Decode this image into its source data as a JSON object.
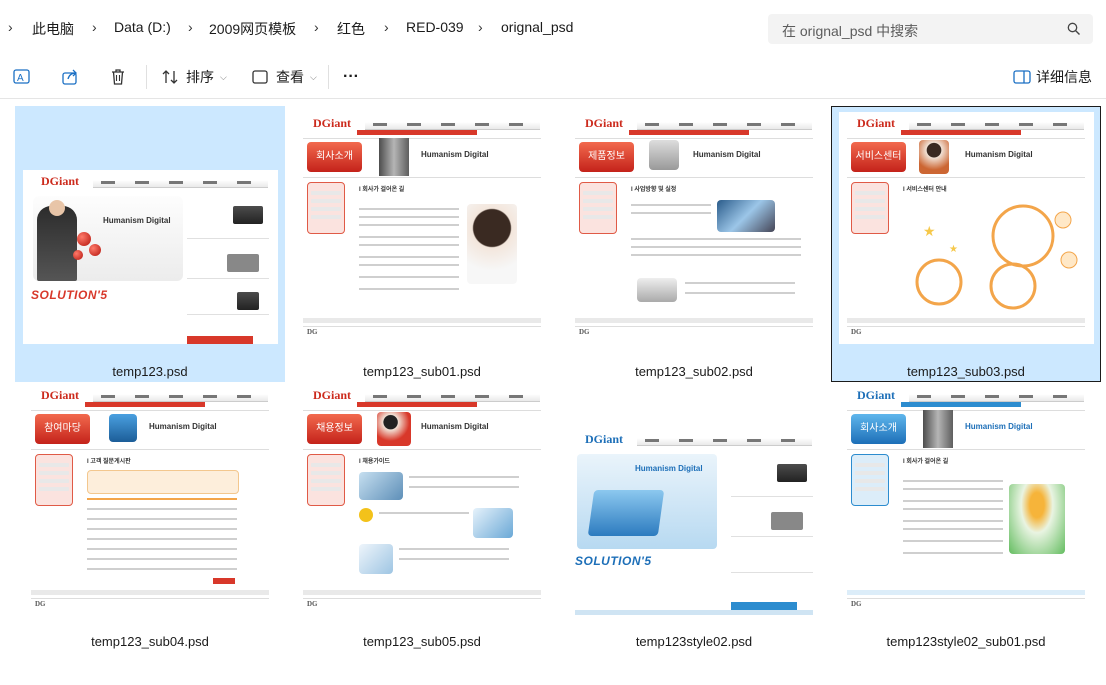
{
  "address_bar": {
    "breadcrumbs": [
      "此电脑",
      "Data (D:)",
      "2009网页模板",
      "红色",
      "RED-039",
      "orignal_psd"
    ],
    "search_placeholder": "在 orignal_psd 中搜索"
  },
  "command_bar": {
    "sort_label": "排序",
    "view_label": "查看",
    "more_label": "···",
    "details_label": "详细信息"
  },
  "files": [
    {
      "name": "temp123.psd",
      "selected": true
    },
    {
      "name": "temp123_sub01.psd",
      "selected": false
    },
    {
      "name": "temp123_sub02.psd",
      "selected": false
    },
    {
      "name": "temp123_sub03.psd",
      "selected": true,
      "focused": true
    },
    {
      "name": "temp123_sub04.psd",
      "selected": false
    },
    {
      "name": "temp123_sub05.psd",
      "selected": false
    },
    {
      "name": "temp123style02.psd",
      "selected": false
    },
    {
      "name": "temp123style02_sub01.psd",
      "selected": false
    }
  ],
  "thumbnail_text": {
    "logo": "DGiant",
    "home_slogan": "Humanism Digital",
    "home_solution": "SOLUTION'5",
    "sub01_banner": "회사소개",
    "sub02_banner": "제품정보",
    "sub03_banner": "서비스센터",
    "sub04_banner": "참여마당",
    "sub05_banner": "채용정보",
    "sub_blue_banner": "회사소개",
    "sub01_title": "I 회사가 걸어온 길",
    "sub02_title": "I 사업방향 및 실정",
    "sub03_title": "I 서비스센터 안내",
    "sub04_title": "I 고객 질문게시판",
    "sub05_title": "I 채용가이드"
  },
  "colors": {
    "selection": "#cce8ff",
    "accent_red": "#d8382a",
    "accent_blue": "#2c8ccf"
  }
}
